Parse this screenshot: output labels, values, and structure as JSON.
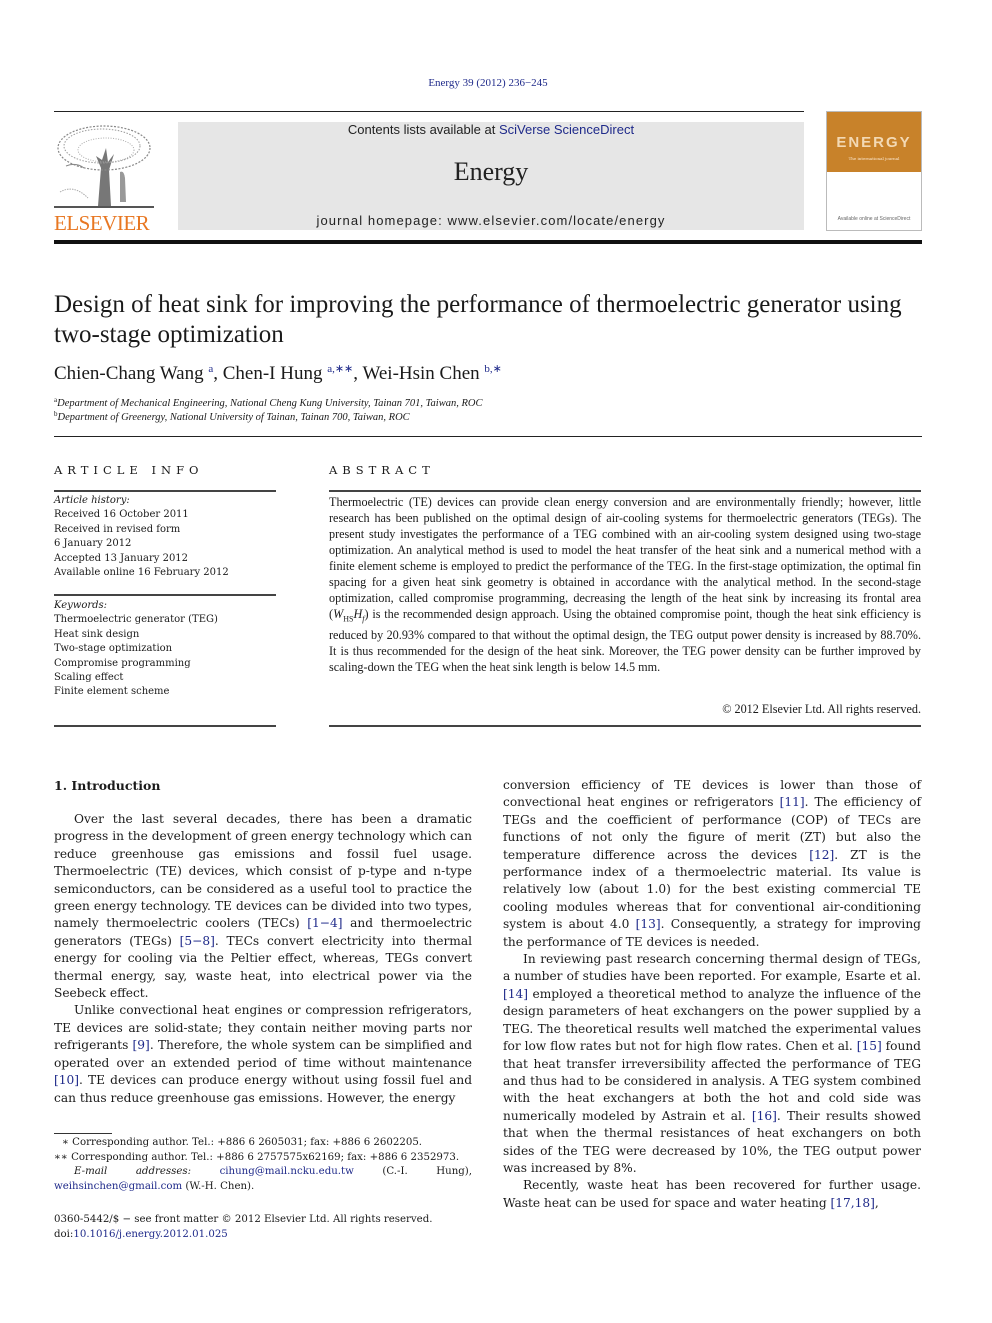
{
  "citation": "Energy 39 (2012) 236−245",
  "header": {
    "contents_prefix": "Contents lists available at ",
    "contents_link": "SciVerse ScienceDirect",
    "journal_name": "Energy",
    "homepage": "journal homepage: www.elsevier.com/locate/energy",
    "publisher_logo_text": "ELSEVIER",
    "cover_title": "ENERGY",
    "cover_subtitle": "The international journal",
    "cover_footer": "Available online at ScienceDirect",
    "colors": {
      "publisher_orange": "#e87722",
      "cover_orange": "#c8822a",
      "link_blue": "#1f2a8a",
      "header_gray": "#e6e6e6"
    }
  },
  "article": {
    "title": "Design of heat sink for improving the performance of thermoelectric generator using two-stage optimization",
    "authors": [
      {
        "name": "Chien-Chang Wang",
        "sup": "a"
      },
      {
        "name": "Chen-I Hung",
        "sup": "a,∗∗"
      },
      {
        "name": "Wei-Hsin Chen",
        "sup": "b,∗"
      }
    ],
    "affiliations": [
      {
        "mark": "a",
        "text": "Department of Mechanical Engineering, National Cheng Kung University, Tainan 701, Taiwan, ROC"
      },
      {
        "mark": "b",
        "text": "Department of Greenergy, National University of Tainan, Tainan 700, Taiwan, ROC"
      }
    ]
  },
  "article_info": {
    "heading": "ARTICLE INFO",
    "history_label": "Article history:",
    "history": [
      "Received 16 October 2011",
      "Received in revised form",
      "6 January 2012",
      "Accepted 13 January 2012",
      "Available online 16 February 2012"
    ],
    "keywords_label": "Keywords:",
    "keywords": [
      "Thermoelectric generator (TEG)",
      "Heat sink design",
      "Two-stage optimization",
      "Compromise programming",
      "Scaling effect",
      "Finite element scheme"
    ]
  },
  "abstract": {
    "heading": "ABSTRACT",
    "text_part1": "Thermoelectric (TE) devices can provide clean energy conversion and are environmentally friendly; however, little research has been published on the optimal design of air-cooling systems for thermoelectric generators (TEGs). The present study investigates the performance of a TEG combined with an air-cooling system designed using two-stage optimization. An analytical method is used to model the heat transfer of the heat sink and a numerical method with a finite element scheme is employed to predict the performance of the TEG. In the first-stage optimization, the optimal fin spacing for a given heat sink geometry is obtained in accordance with the analytical method. In the second-stage optimization, called compromise programming, decreasing the length of the heat sink by increasing its frontal area (",
    "math_W": "W",
    "math_W_sub": "HS",
    "math_H": "H",
    "math_H_sub": "f",
    "text_part2": ") is the recommended design approach. Using the obtained compromise point, though the heat sink efficiency is reduced by 20.93% compared to that without the optimal design, the TEG output power density is increased by 88.70%. It is thus recommended for the design of the heat sink. Moreover, the TEG power density can be further improved by scaling-down the TEG when the heat sink length is below 14.5 mm.",
    "copyright": "© 2012 Elsevier Ltd. All rights reserved."
  },
  "body": {
    "section_title": "1.  Introduction",
    "left": {
      "p1_a": "Over the last several decades, there has been a dramatic progress in the development of green energy technology which can reduce greenhouse gas emissions and fossil fuel usage. Thermoelectric (TE) devices, which consist of p-type and n-type semiconductors, can be considered as a useful tool to practice the green energy technology. TE devices can be divided into two types, namely thermoelectric coolers (TECs) ",
      "ref_1_4": "[1−4]",
      "p1_b": " and thermoelectric generators (TEGs) ",
      "ref_5_8": "[5−8]",
      "p1_c": ". TECs convert electricity into thermal energy for cooling via the Peltier effect, whereas, TEGs convert thermal energy, say, waste heat, into electrical power via the Seebeck effect.",
      "p2_a": "Unlike convectional heat engines or compression refrigerators, TE devices are solid-state; they contain neither moving parts nor refrigerants ",
      "ref_9": "[9]",
      "p2_b": ". Therefore, the whole system can be simplified and operated over an extended period of time without maintenance ",
      "ref_10": "[10]",
      "p2_c": ". TE devices can produce energy without using fossil fuel and can thus reduce greenhouse gas emissions. However, the energy"
    },
    "right": {
      "p1_a": "conversion efficiency of TE devices is lower than those of convectional heat engines or refrigerators ",
      "ref_11": "[11]",
      "p1_b": ". The efficiency of TEGs and the coefficient of performance (COP) of TECs are functions of not only the figure of merit (ZT) but also the temperature difference across the devices ",
      "ref_12": "[12]",
      "p1_c": ". ZT is the performance index of a thermoelectric material. Its value is relatively low (about 1.0) for the best existing commercial TE cooling modules whereas that for conventional air-conditioning system is about 4.0 ",
      "ref_13": "[13]",
      "p1_d": ". Consequently, a strategy for improving the performance of TE devices is needed.",
      "p2_a": "In reviewing past research concerning thermal design of TEGs, a number of studies have been reported. For example, Esarte et al. ",
      "ref_14": "[14]",
      "p2_b": " employed a theoretical method to analyze the influence of the design parameters of heat exchangers on the power supplied by a TEG. The theoretical results well matched the experimental values for low flow rates but not for high flow rates. Chen et al. ",
      "ref_15": "[15]",
      "p2_c": " found that heat transfer irreversibility affected the performance of TEG and thus had to be considered in analysis. A TEG system combined with the heat exchangers at both the hot and cold side was numerically modeled by Astrain et al. ",
      "ref_16": "[16]",
      "p2_d": ". Their results showed that when the thermal resistances of heat exchangers on both sides of the TEG were decreased by 10%, the TEG output power was increased by 8%.",
      "p3_a": "Recently, waste heat has been recovered for further usage. Waste heat can be used for space and water heating ",
      "ref_17_18": "[17,18]",
      "p3_b": ","
    }
  },
  "footnotes": {
    "fn1": "∗  Corresponding author. Tel.: +886 6 2605031; fax: +886 6 2602205.",
    "fn2": "∗∗  Corresponding author. Tel.: +886 6 2757575x62169; fax: +886 6 2352973.",
    "email_label": "E-mail addresses:",
    "email1": "cihung@mail.ncku.edu.tw",
    "email1_owner": " (C.-I. Hung), ",
    "email2": "weihsinchen@gmail.com",
    "email2_owner": " (W.-H. Chen).",
    "front_matter": "0360-5442/$ − see front matter © 2012 Elsevier Ltd. All rights reserved.",
    "doi_prefix": "doi:",
    "doi": "10.1016/j.energy.2012.01.025"
  }
}
